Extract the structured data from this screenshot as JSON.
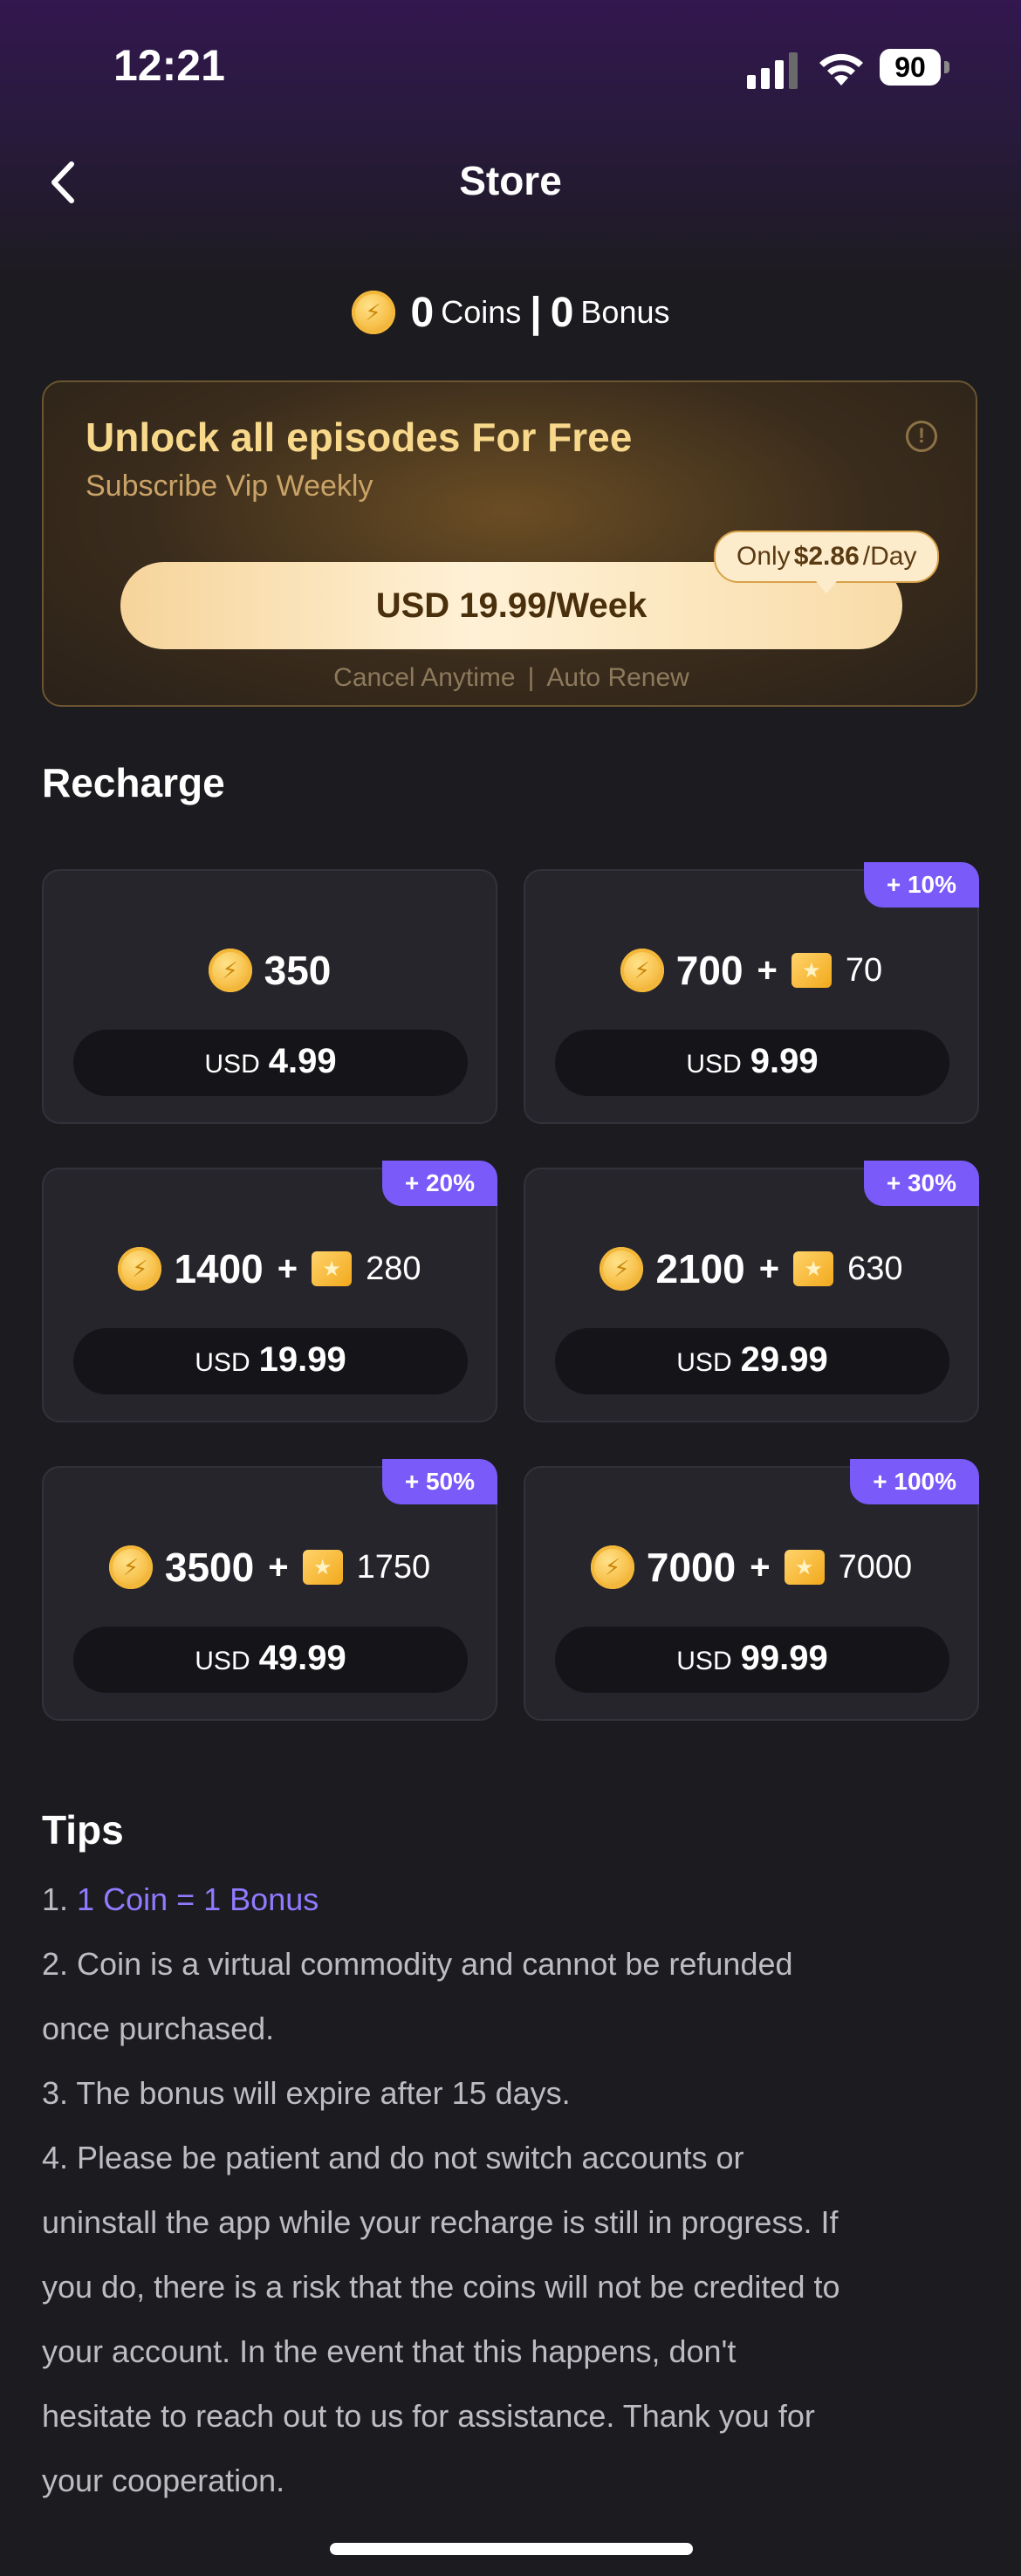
{
  "status_bar": {
    "time": "12:21",
    "battery": "90"
  },
  "nav": {
    "title": "Store"
  },
  "balance": {
    "coins_value": "0",
    "coins_label": "Coins",
    "separator": "|",
    "bonus_value": "0",
    "bonus_label": "Bonus"
  },
  "vip": {
    "title": "Unlock all episodes For Free",
    "subtitle": "Subscribe Vip Weekly",
    "button_label": "USD 19.99/Week",
    "tip_prefix": "Only",
    "tip_price": "$2.86",
    "tip_suffix": "/Day",
    "cancel_text": "Cancel Anytime",
    "footer_sep": "|",
    "renew_text": "Auto Renew"
  },
  "recharge": {
    "title": "Recharge",
    "packages": [
      {
        "coins": "350",
        "bonus": "",
        "badge": "",
        "currency": "USD",
        "price": "4.99"
      },
      {
        "coins": "700",
        "bonus": "70",
        "badge": "+ 10%",
        "currency": "USD",
        "price": "9.99"
      },
      {
        "coins": "1400",
        "bonus": "280",
        "badge": "+ 20%",
        "currency": "USD",
        "price": "19.99"
      },
      {
        "coins": "2100",
        "bonus": "630",
        "badge": "+ 30%",
        "currency": "USD",
        "price": "29.99"
      },
      {
        "coins": "3500",
        "bonus": "1750",
        "badge": "+ 50%",
        "currency": "USD",
        "price": "49.99"
      },
      {
        "coins": "7000",
        "bonus": "7000",
        "badge": "+ 100%",
        "currency": "USD",
        "price": "99.99"
      }
    ],
    "plus": "+"
  },
  "tips": {
    "title": "Tips",
    "items": [
      {
        "num": "1.",
        "text": "1 Coin = 1 Bonus"
      },
      {
        "num": "2.",
        "text": "Coin is a virtual commodity and cannot be refunded"
      },
      {
        "num": "",
        "text": "once purchased."
      },
      {
        "num": "3.",
        "text": "The bonus will expire after 15 days."
      },
      {
        "num": "4.",
        "text": "Please be patient and do not switch accounts or"
      },
      {
        "num": "",
        "text": "uninstall the app while your recharge is still in progress. If"
      },
      {
        "num": "",
        "text": "you do, there is a risk that the coins will not be credited to"
      },
      {
        "num": "",
        "text": "your account. In the event that this happens, don't"
      },
      {
        "num": "",
        "text": "hesitate to reach out to us for assistance. Thank you for"
      },
      {
        "num": "",
        "text": "your cooperation."
      }
    ]
  },
  "colors": {
    "accent": "#7a5af8",
    "gold": "#f8d98c",
    "background": "#1c1b1f"
  }
}
